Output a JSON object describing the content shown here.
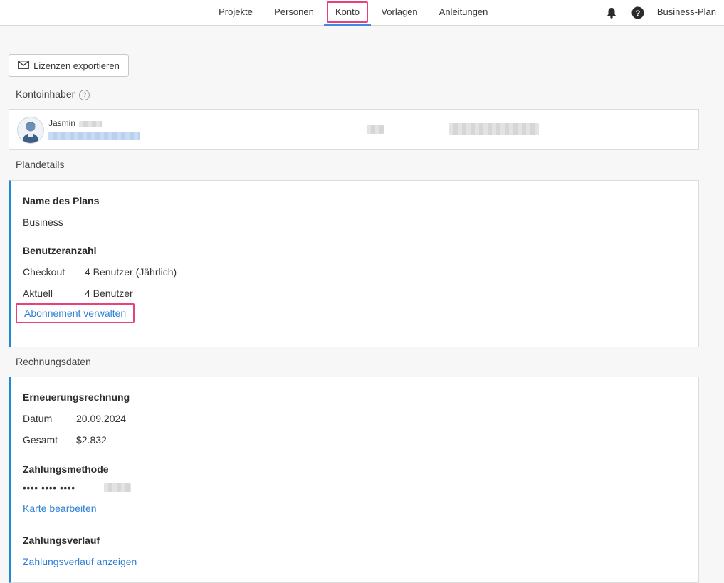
{
  "nav": {
    "items": [
      {
        "label": "Projekte"
      },
      {
        "label": "Personen"
      },
      {
        "label": "Konto"
      },
      {
        "label": "Vorlagen"
      },
      {
        "label": "Anleitungen"
      }
    ],
    "active_index": 2,
    "notifications_icon": "bell-icon",
    "help_icon": "question-circle-icon",
    "plan_label": "Business-Plan"
  },
  "export_button": {
    "label": "Lizenzen exportieren",
    "icon": "envelope-icon"
  },
  "account_owner": {
    "section_title": "Kontoinhaber",
    "first_name": "Jasmin"
  },
  "plan_details": {
    "section_title": "Plandetails",
    "plan_name_heading": "Name des Plans",
    "plan_name": "Business",
    "user_count_heading": "Benutzeranzahl",
    "checkout_label": "Checkout",
    "checkout_value": "4 Benutzer (Jährlich)",
    "current_label": "Aktuell",
    "current_value": "4 Benutzer",
    "manage_link": "Abonnement verwalten"
  },
  "billing": {
    "section_title": "Rechnungsdaten",
    "renewal_heading": "Erneuerungsrechnung",
    "date_label": "Datum",
    "date_value": "20.09.2024",
    "total_label": "Gesamt",
    "total_value": "$2.832",
    "payment_heading": "Zahlungsmethode",
    "card_masked": "•••• •••• ••••",
    "edit_card_link": "Karte bearbeiten",
    "history_heading": "Zahlungsverlauf",
    "history_link": "Zahlungsverlauf anzeigen"
  },
  "colors": {
    "accent": "#1e8ad6",
    "link": "#2f7fd8",
    "highlight": "#e8417d",
    "active_tab": "#3d8be8"
  }
}
